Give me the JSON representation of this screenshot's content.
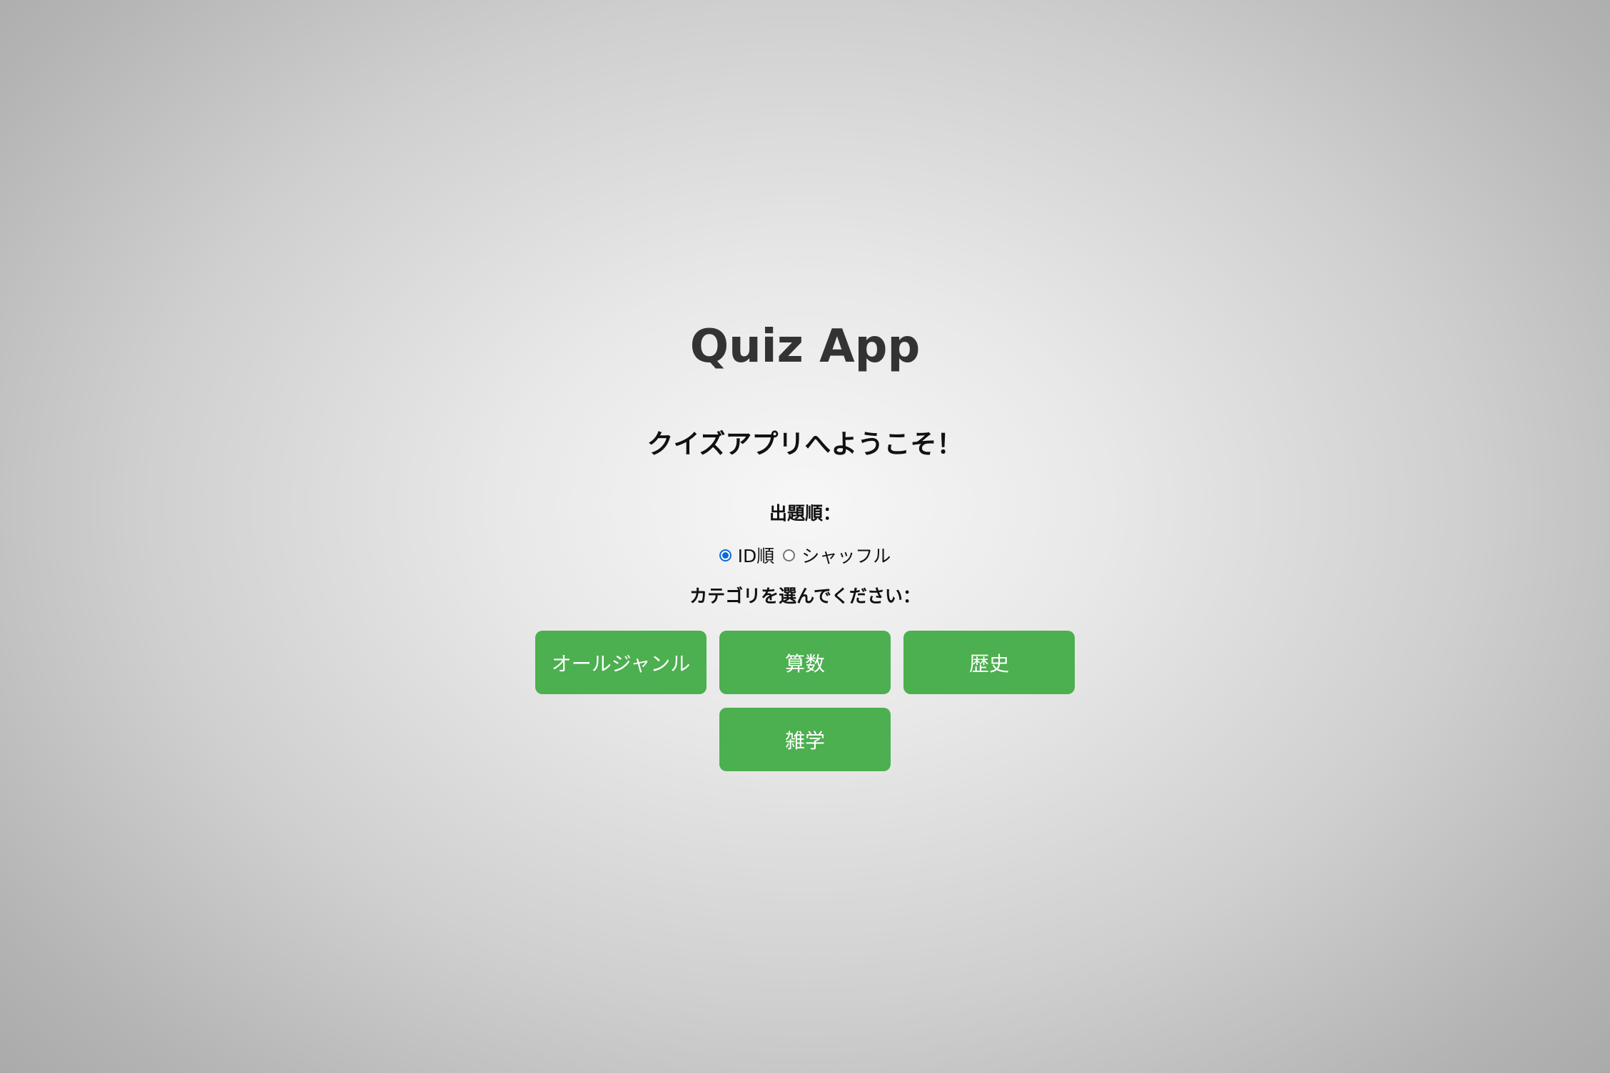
{
  "app": {
    "title": "Quiz App",
    "welcome": "クイズアプリへようこそ！"
  },
  "order": {
    "label": "出題順：",
    "options": [
      {
        "label": "ID順",
        "checked": true
      },
      {
        "label": "シャッフル",
        "checked": false
      }
    ]
  },
  "category": {
    "label": "カテゴリを選んでください：",
    "buttons": [
      {
        "label": "オールジャンル"
      },
      {
        "label": "算数"
      },
      {
        "label": "歴史"
      },
      {
        "label": "雑学"
      }
    ]
  },
  "colors": {
    "button_bg": "#4caf50",
    "button_text": "#ffffff",
    "radio_accent": "#0a6ad8",
    "title_text": "#333333"
  },
  "icons": {
    "radio_checked": "radio-checked-icon",
    "radio_unchecked": "radio-unchecked-icon"
  }
}
